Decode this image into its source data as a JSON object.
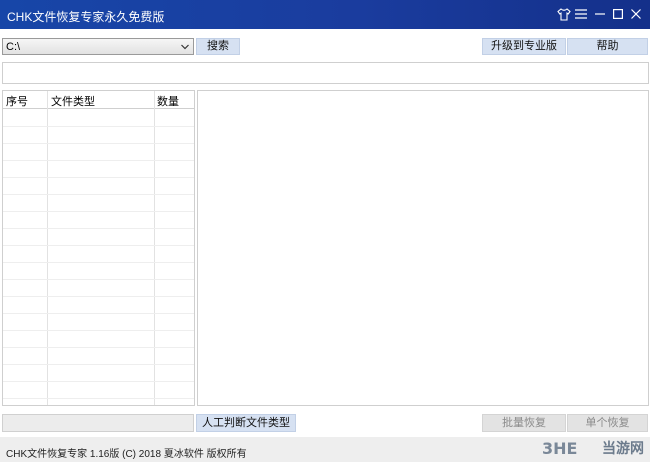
{
  "window": {
    "title": "CHK文件恢复专家永久免费版",
    "controls": [
      "shirt-icon",
      "menu-icon",
      "minimize-icon",
      "maximize-icon",
      "close-icon"
    ]
  },
  "toolbar": {
    "drive_value": "C:\\",
    "search_label": "搜索",
    "upgrade_label": "升级到专业版",
    "help_label": "帮助"
  },
  "path_field": {
    "value": ""
  },
  "file_types_table": {
    "columns": [
      "序号",
      "文件类型",
      "数量"
    ],
    "rows": []
  },
  "bottom": {
    "status_value": "",
    "manual_label": "人工判断文件类型",
    "batch_label": "批量恢复",
    "single_label": "单个恢复"
  },
  "footer": {
    "text": "CHK文件恢复专家 1.16版 (C) 2018 夏冰软件 版权所有"
  },
  "watermark": {
    "logo": "3HE",
    "text": "当游网"
  },
  "colors": {
    "titlebar": "#1a3c9e",
    "button": "#d6e1f2",
    "disabled_button": "#e3e3e3"
  }
}
